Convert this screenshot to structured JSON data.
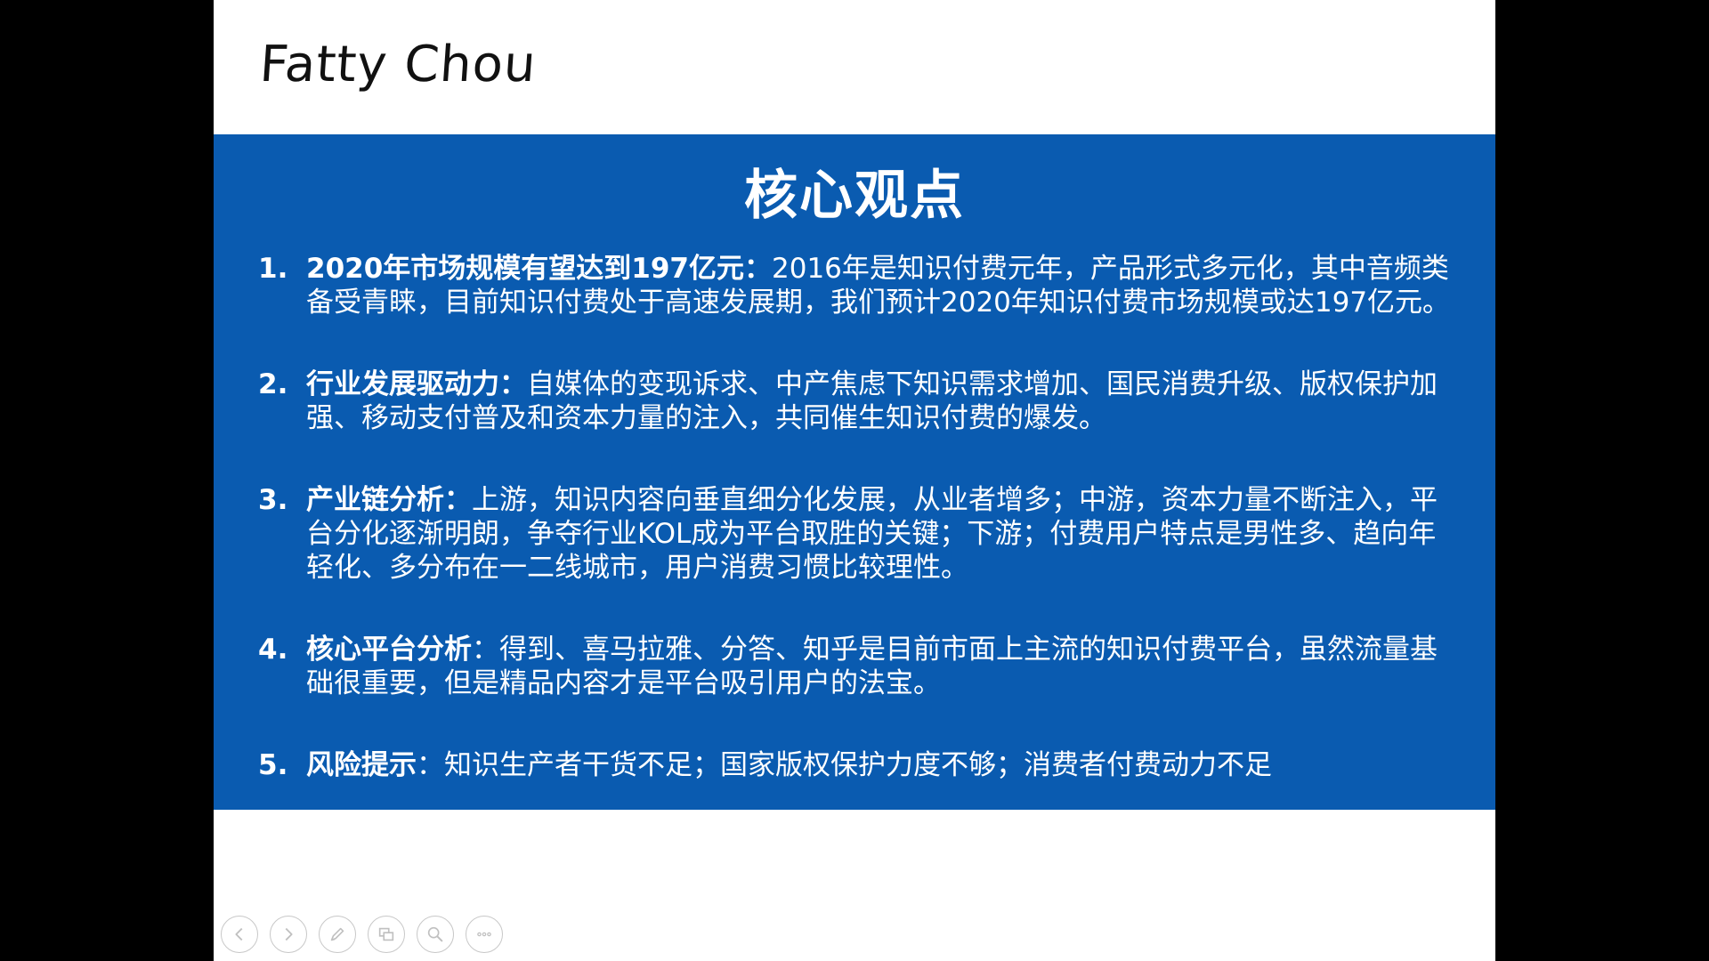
{
  "slide": {
    "brand": "Fatty Chou",
    "title": "核心观点",
    "points": [
      {
        "number": "1.",
        "heading": "2020年市场规模有望达到197亿元：",
        "body": "2016年是知识付费元年，产品形式多元化，其中音频类备受青睐，目前知识付费处于高速发展期，我们预计2020年知识付费市场规模或达197亿元。"
      },
      {
        "number": "2.",
        "heading": "行业发展驱动力：",
        "body": "自媒体的变现诉求、中产焦虑下知识需求增加、国民消费升级、版权保护加强、移动支付普及和资本力量的注入，共同催生知识付费的爆发。"
      },
      {
        "number": "3.",
        "heading": "产业链分析：",
        "body": "上游，知识内容向垂直细分化发展，从业者增多；中游，资本力量不断注入，平台分化逐渐明朗，争夺行业KOL成为平台取胜的关键；下游；付费用户特点是男性多、趋向年轻化、多分布在一二线城市，用户消费习惯比较理性。"
      },
      {
        "number": "4.",
        "heading": "核心平台分析",
        "body": "：得到、喜马拉雅、分答、知乎是目前市面上主流的知识付费平台，虽然流量基础很重要，但是精品内容才是平台吸引用户的法宝。"
      },
      {
        "number": "5.",
        "heading": "风险提示",
        "body": "：知识生产者干货不足；国家版权保护力度不够；消费者付费动力不足"
      }
    ]
  },
  "controls": [
    {
      "icon": "previous-arrow-icon"
    },
    {
      "icon": "next-arrow-icon"
    },
    {
      "icon": "pen-icon"
    },
    {
      "icon": "slides-grid-icon"
    },
    {
      "icon": "zoom-icon"
    },
    {
      "icon": "more-icon"
    }
  ],
  "colors": {
    "band": "#0a5bb0",
    "text_on_band": "#ffffff",
    "outer_background": "#000000"
  }
}
